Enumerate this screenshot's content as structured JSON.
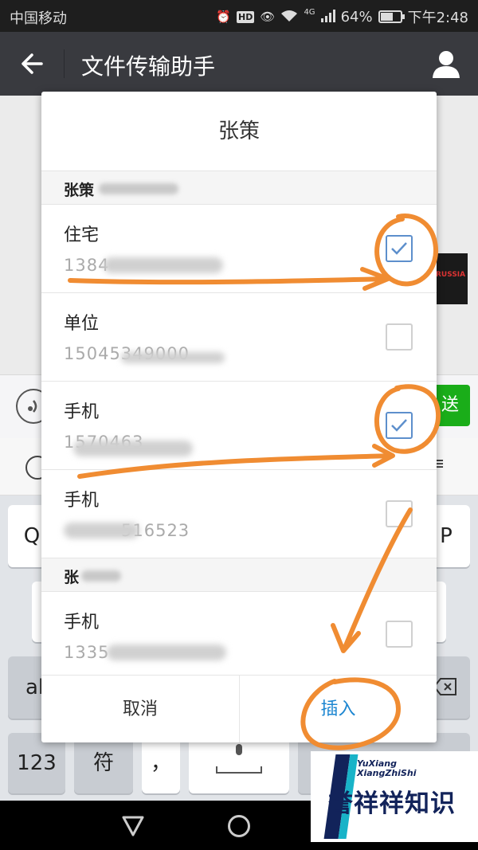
{
  "status_bar": {
    "carrier": "中国移动",
    "network": "4G",
    "battery": "64%",
    "battery_fraction": 0.64,
    "time": "下午2:48"
  },
  "title_bar": {
    "title": "文件传输助手"
  },
  "chat": {
    "send_label": "送"
  },
  "keyboard": {
    "row1": [
      "Q",
      "P"
    ],
    "row2_left": "al",
    "bottom_row": [
      "123",
      "符",
      "，"
    ]
  },
  "dialog": {
    "title": "张策",
    "contacts": [
      {
        "header": "张策",
        "entries": [
          {
            "label": "住宅",
            "phone": "1384",
            "checked": true
          },
          {
            "label": "单位",
            "phone": "15045349000",
            "checked": false
          },
          {
            "label": "手机",
            "phone": "1570463",
            "checked": true
          },
          {
            "label": "手机",
            "phone": "516523",
            "checked": false
          }
        ]
      },
      {
        "header": "张",
        "entries": [
          {
            "label": "手机",
            "phone": "1335",
            "checked": false
          }
        ]
      }
    ],
    "cancel_label": "取消",
    "insert_label": "插入"
  },
  "colors": {
    "title_bar": "#393a3f",
    "checkbox_checked": "#5d8fcc",
    "insert_button": "#1c86d1",
    "send_button": "#1aad19",
    "annotation_orange": "#f08c32"
  },
  "watermark": {
    "small_line1": "YuXiang",
    "small_line2": "XiangZhiShi",
    "big_text": "誉祥祥知识"
  }
}
